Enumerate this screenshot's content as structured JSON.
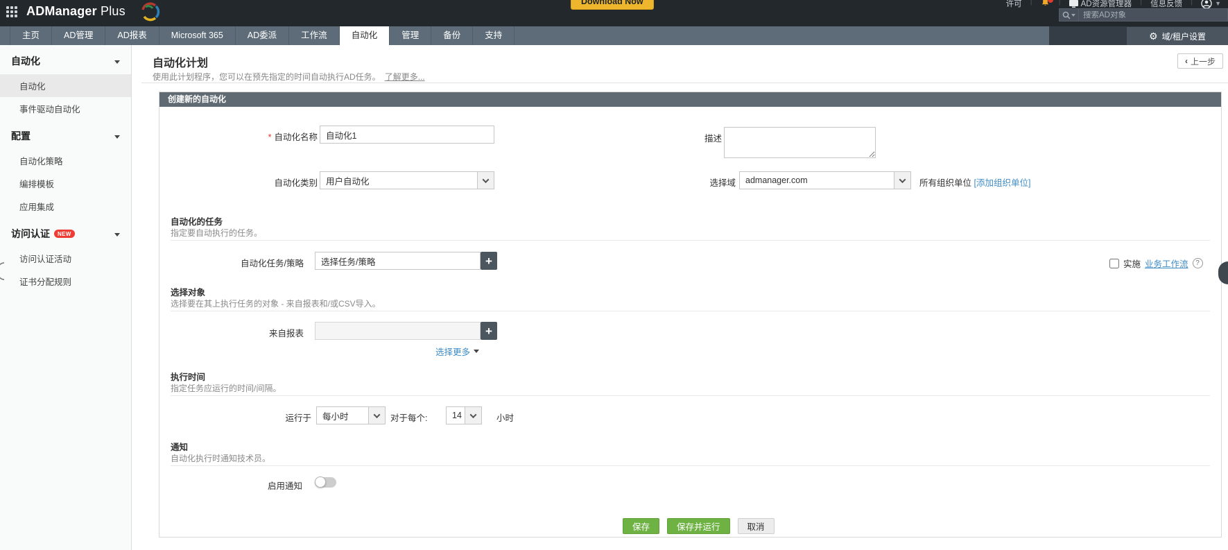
{
  "topbar": {
    "app_name_bold": "ADManager",
    "app_name_light": "Plus",
    "download_button": "Download Now",
    "license": "许可",
    "ad_explorer": "AD资源管理器",
    "feedback": "信息反馈",
    "search_placeholder": "搜索AD对象"
  },
  "nav": {
    "tabs": [
      {
        "label": "主页"
      },
      {
        "label": "AD管理"
      },
      {
        "label": "AD报表"
      },
      {
        "label": "Microsoft 365"
      },
      {
        "label": "AD委派"
      },
      {
        "label": "工作流"
      },
      {
        "label": "自动化",
        "active": true
      },
      {
        "label": "管理"
      },
      {
        "label": "备份"
      },
      {
        "label": "支持"
      }
    ],
    "settings_button": "域/租户设置"
  },
  "sidebar": {
    "sections": [
      {
        "title": "自动化",
        "items": [
          {
            "label": "自动化",
            "selected": true
          },
          {
            "label": "事件驱动自动化"
          }
        ]
      },
      {
        "title": "配置",
        "items": [
          {
            "label": "自动化策略"
          },
          {
            "label": "编排模板"
          },
          {
            "label": "应用集成"
          }
        ]
      },
      {
        "title": "访问认证",
        "badge": "NEW",
        "items": [
          {
            "label": "访问认证活动"
          },
          {
            "label": "证书分配规则"
          }
        ]
      }
    ]
  },
  "page": {
    "title": "自动化计划",
    "subtitle": "使用此计划程序，您可以在预先指定的时间自动执行AD任务。",
    "learn_more": "了解更多...",
    "back_button": "上一步"
  },
  "form": {
    "panel_title": "创建新的自动化",
    "name": {
      "label": "自动化名称",
      "value": "自动化1"
    },
    "description": {
      "label": "描述",
      "value": ""
    },
    "category": {
      "label": "自动化类别",
      "value": "用户自动化"
    },
    "domain": {
      "label": "选择域",
      "value": "admanager.com",
      "ou_text": "所有组织单位",
      "ou_link": "[添加组织单位]"
    },
    "tasks_section": {
      "title": "自动化的任务",
      "desc": "指定要自动执行的任务。",
      "task_label": "自动化任务/策略",
      "task_value": "选择任务/策略",
      "workflow_checkbox": "实施",
      "workflow_link": "业务工作流",
      "help": "?"
    },
    "objects_section": {
      "title": "选择对象",
      "desc": "选择要在其上执行任务的对象 - 来自报表和/或CSV导入。",
      "report_label": "来自报表",
      "report_value": "",
      "more_link": "选择更多"
    },
    "schedule_section": {
      "title": "执行时间",
      "desc": "指定任务应运行的时间/间隔。",
      "run_label": "运行于",
      "run_value": "每小时",
      "every_label": "对于每个:",
      "every_value": "14",
      "unit": "小时"
    },
    "notify_section": {
      "title": "通知",
      "desc": "自动化执行时通知技术员。",
      "toggle_label": "启用通知"
    },
    "buttons": {
      "save": "保存",
      "save_run": "保存并运行",
      "cancel": "取消"
    }
  },
  "colors": {
    "topbar": "#23282d",
    "tabbar": "#5d6c78",
    "panel_header": "#5f6a73",
    "accent_green": "#6fb244",
    "link_blue": "#3f8cc6",
    "badge_red": "#ee3b33",
    "download_yellow": "#edb62c"
  }
}
